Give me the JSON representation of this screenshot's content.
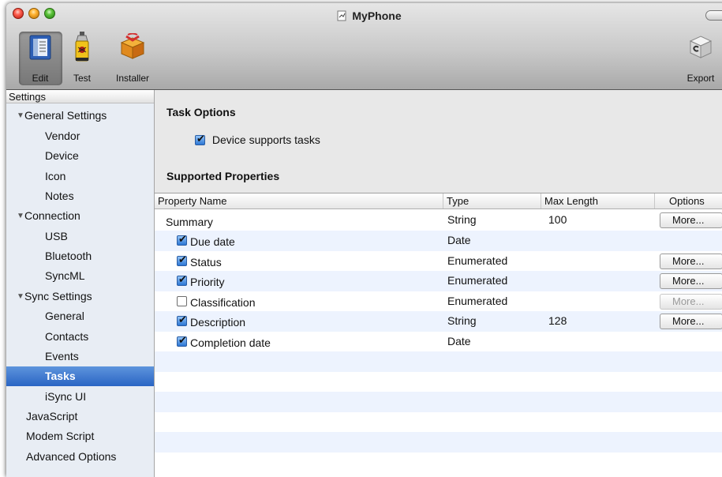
{
  "window": {
    "title": "MyPhone"
  },
  "toolbar": {
    "edit_label": "Edit",
    "test_label": "Test",
    "installer_label": "Installer",
    "export_label": "Export"
  },
  "sidebar": {
    "header": "Settings",
    "items": [
      {
        "label": "General Settings",
        "group": true
      },
      {
        "label": "Vendor"
      },
      {
        "label": "Device"
      },
      {
        "label": "Icon"
      },
      {
        "label": "Notes"
      },
      {
        "label": "Connection",
        "group": true
      },
      {
        "label": "USB"
      },
      {
        "label": "Bluetooth"
      },
      {
        "label": "SyncML"
      },
      {
        "label": "Sync Settings",
        "group": true
      },
      {
        "label": "General"
      },
      {
        "label": "Contacts"
      },
      {
        "label": "Events"
      },
      {
        "label": "Tasks",
        "selected": true
      },
      {
        "label": "iSync UI"
      },
      {
        "label": "JavaScript"
      },
      {
        "label": "Modem Script"
      },
      {
        "label": "Advanced Options"
      }
    ]
  },
  "main": {
    "task_options_title": "Task Options",
    "device_supports_tasks_label": "Device supports tasks",
    "device_supports_tasks_checked": true,
    "supported_properties_title": "Supported Properties"
  },
  "table": {
    "columns": [
      "Property Name",
      "Type",
      "Max Length",
      "Options"
    ],
    "rows": [
      {
        "name": "Summary",
        "checkbox": false,
        "checked": null,
        "type": "String",
        "max_length": "100",
        "options": "More...",
        "options_enabled": true
      },
      {
        "name": "Due date",
        "checkbox": true,
        "checked": true,
        "type": "Date",
        "max_length": "",
        "options": "",
        "options_enabled": false
      },
      {
        "name": "Status",
        "checkbox": true,
        "checked": true,
        "type": "Enumerated",
        "max_length": "",
        "options": "More...",
        "options_enabled": true
      },
      {
        "name": "Priority",
        "checkbox": true,
        "checked": true,
        "type": "Enumerated",
        "max_length": "",
        "options": "More...",
        "options_enabled": true
      },
      {
        "name": "Classification",
        "checkbox": true,
        "checked": false,
        "type": "Enumerated",
        "max_length": "",
        "options": "More...",
        "options_enabled": false
      },
      {
        "name": "Description",
        "checkbox": true,
        "checked": true,
        "type": "String",
        "max_length": "128",
        "options": "More...",
        "options_enabled": true
      },
      {
        "name": "Completion date",
        "checkbox": true,
        "checked": true,
        "type": "Date",
        "max_length": "",
        "options": "",
        "options_enabled": false
      }
    ]
  },
  "colors": {
    "selection": "#2f6bc8",
    "row_alt": "#edf3fe",
    "checkbox_checked": "#2c76d4"
  }
}
